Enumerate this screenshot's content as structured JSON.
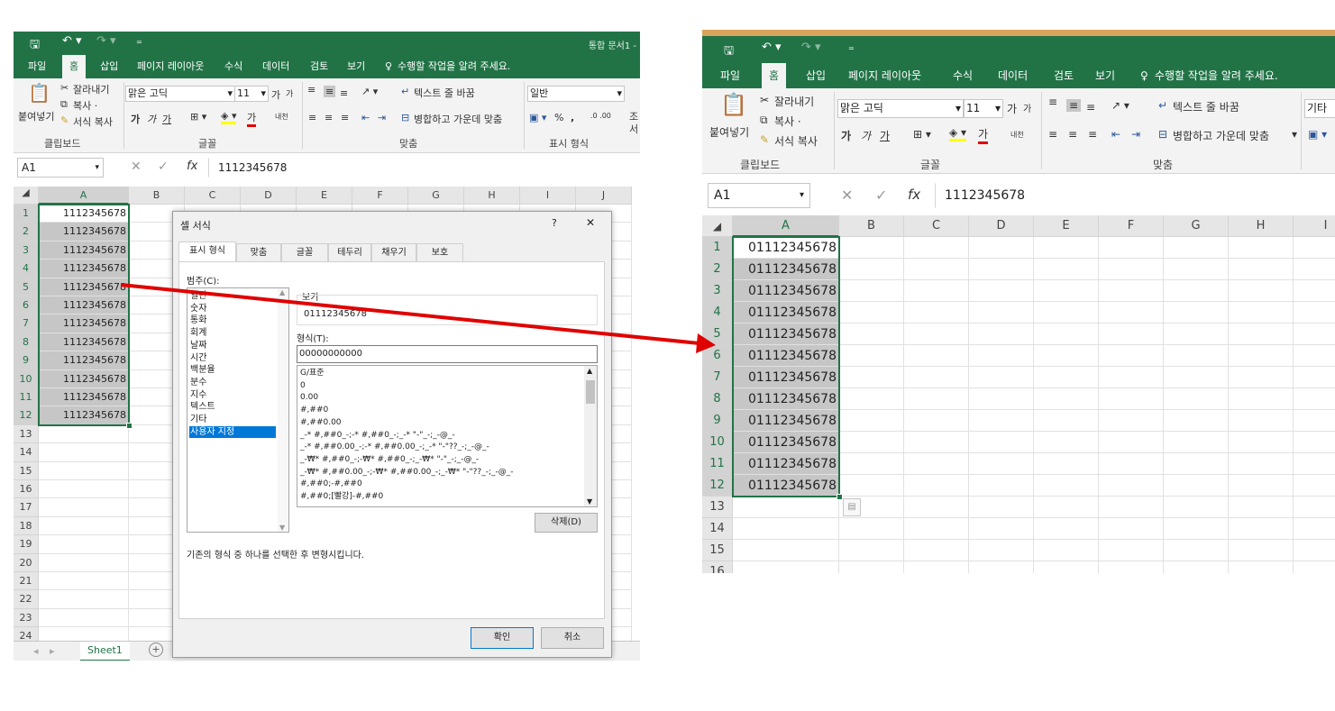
{
  "left_window": {
    "document_title": "통합 문서1 -",
    "qat_icons": [
      "save-icon",
      "undo-icon",
      "redo-icon",
      "customize-icon"
    ],
    "menu_tabs": [
      "파일",
      "홈",
      "삽입",
      "페이지 레이아웃",
      "수식",
      "데이터",
      "검토",
      "보기"
    ],
    "tell_me": "수행할 작업을 알려 주세요.",
    "ribbon": {
      "paste": "붙여넣기",
      "cut": "잘라내기",
      "copy": "복사 ·",
      "format_painter": "서식 복사",
      "clipboard_group": "클립보드",
      "font_name": "맑은 고딕",
      "font_size": "11",
      "font_grow": "가",
      "font_shrink": "가",
      "bold": "가",
      "italic": "가",
      "underline": "가",
      "font_color": "가",
      "phonetic": "내천",
      "font_group": "글꼴",
      "wrap_text": "텍스트 줄 바꿈",
      "merge_center": "병합하고 가운데 맞춤",
      "align_group": "맞춤",
      "number_format": "일반",
      "percent": "%",
      "comma": ",",
      "number_group": "표시 형식",
      "extra": "조",
      "extra2": "서"
    },
    "name_box": "A1",
    "fx": "fx",
    "formula": "1112345678",
    "columns": [
      "A",
      "B",
      "C",
      "D",
      "E",
      "F",
      "G",
      "H",
      "I",
      "J"
    ],
    "rows": [
      "1",
      "2",
      "3",
      "4",
      "5",
      "6",
      "7",
      "8",
      "9",
      "10",
      "11",
      "12",
      "13",
      "14",
      "15",
      "16",
      "17",
      "18",
      "19",
      "20",
      "21",
      "22",
      "23",
      "24"
    ],
    "cells_a": [
      "1112345678",
      "1112345678",
      "1112345678",
      "1112345678",
      "1112345678",
      "1112345678",
      "1112345678",
      "1112345678",
      "1112345678",
      "1112345678",
      "1112345678",
      "1112345678"
    ],
    "sheet_tab": "Sheet1",
    "add_sheet": "+"
  },
  "dialog": {
    "title": "셀 서식",
    "help": "?",
    "close": "✕",
    "tabs": [
      "표시 형식",
      "맞춤",
      "글꼴",
      "테두리",
      "채우기",
      "보호"
    ],
    "category_label": "범주(C):",
    "categories": [
      "일반",
      "숫자",
      "통화",
      "회계",
      "날짜",
      "시간",
      "백분율",
      "분수",
      "지수",
      "텍스트",
      "기타",
      "사용자 지정"
    ],
    "selected_category": "사용자 지정",
    "sample_label": "보기",
    "sample_value": "01112345678",
    "type_label": "형식(T):",
    "type_value": "00000000000",
    "formats": [
      "G/표준",
      "0",
      "0.00",
      "#,##0",
      "#,##0.00",
      "_-* #,##0_-;-* #,##0_-;_-* \"-\"_-;_-@_-",
      "_-* #,##0.00_-;-* #,##0.00_-;_-* \"-\"??_-;_-@_-",
      "_-₩* #,##0_-;-₩* #,##0_-;_-₩* \"-\"_-;_-@_-",
      "_-₩* #,##0.00_-;-₩* #,##0.00_-;_-₩* \"-\"??_-;_-@_-",
      "#,##0;-#,##0",
      "#,##0;[빨강]-#,##0"
    ],
    "delete_button": "삭제(D)",
    "description": "기존의 형식 중 하나를 선택한 후 변형시킵니다.",
    "ok_button": "확인",
    "cancel_button": "취소"
  },
  "right_window": {
    "qat_icons": [
      "save-icon",
      "undo-icon",
      "redo-icon",
      "customize-icon"
    ],
    "menu_tabs": [
      "파일",
      "홈",
      "삽입",
      "페이지 레이아웃",
      "수식",
      "데이터",
      "검토",
      "보기"
    ],
    "tell_me": "수행할 작업을 알려 주세요.",
    "ribbon": {
      "paste": "붙여넣기",
      "cut": "잘라내기",
      "copy": "복사 ·",
      "format_painter": "서식 복사",
      "clipboard_group": "클립보드",
      "font_name": "맑은 고딕",
      "font_size": "11",
      "font_grow": "가",
      "font_shrink": "가",
      "bold": "가",
      "italic": "가",
      "underline": "가",
      "font_color": "가",
      "phonetic": "내천",
      "font_group": "글꼴",
      "wrap_text": "텍스트 줄 바꿈",
      "merge_center": "병합하고 가운데 맞춤",
      "align_group": "맞춤",
      "number_format": "기타"
    },
    "name_box": "A1",
    "fx": "fx",
    "formula": "1112345678",
    "columns": [
      "A",
      "B",
      "C",
      "D",
      "E",
      "F",
      "G",
      "H",
      "I"
    ],
    "rows": [
      "1",
      "2",
      "3",
      "4",
      "5",
      "6",
      "7",
      "8",
      "9",
      "10",
      "11",
      "12",
      "13",
      "14",
      "15",
      "16"
    ],
    "cells_a": [
      "01112345678",
      "01112345678",
      "01112345678",
      "01112345678",
      "01112345678",
      "01112345678",
      "01112345678",
      "01112345678",
      "01112345678",
      "01112345678",
      "01112345678",
      "01112345678"
    ]
  },
  "colors": {
    "excel_green": "#217346",
    "arrow_red": "#e00000",
    "selection_blue": "#0078d7"
  }
}
